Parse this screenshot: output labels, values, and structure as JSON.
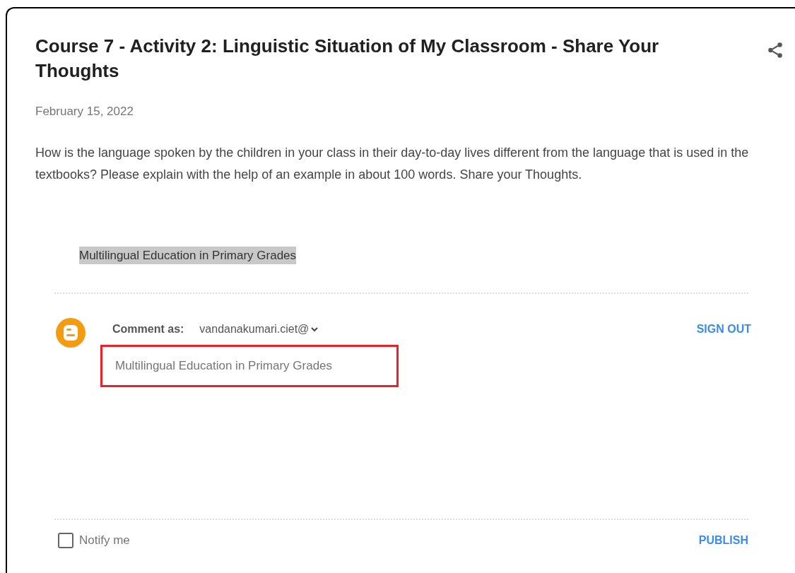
{
  "post": {
    "title": "Course 7 - Activity 2: Linguistic Situation of My Classroom - Share Your Thoughts",
    "date": "February 15, 2022",
    "body": "How is the language spoken by the children in your class in their day-to-day lives different from the language that is used in the textbooks? Please explain with the help of an example in about 100 words. Share your Thoughts.",
    "highlighted_text": "Multilingual Education in Primary Grades"
  },
  "comment_form": {
    "comment_as_label": "Comment as:",
    "account": "vandanakumari.ciet@",
    "sign_out": "SIGN OUT",
    "comment_value": "Multilingual Education in Primary Grades",
    "notify": {
      "label": "Notify me",
      "checked": false
    },
    "publish": "PUBLISH"
  }
}
